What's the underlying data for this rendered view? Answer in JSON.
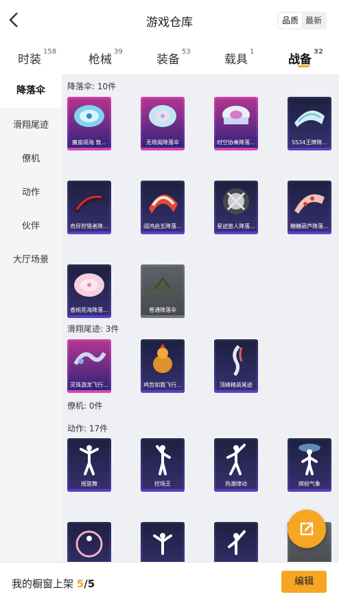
{
  "header": {
    "title": "游戏仓库",
    "sort": {
      "option1": "品质",
      "option2": "最新"
    }
  },
  "tabs": [
    {
      "label": "时装",
      "count": "158"
    },
    {
      "label": "枪械",
      "count": "39"
    },
    {
      "label": "装备",
      "count": "53"
    },
    {
      "label": "载具",
      "count": "1"
    },
    {
      "label": "战备",
      "count": "32"
    }
  ],
  "sidebar": {
    "items": [
      "降落伞",
      "滑翔尾迹",
      "僚机",
      "动作",
      "伙伴",
      "大厅场景"
    ]
  },
  "sections": {
    "parachute": {
      "label": "降落伞: 10件",
      "items": [
        "魔蛮闹海 敖...",
        "无垠阁降落伞",
        "时空协奏降落...",
        "SS34王牌降...",
        "奇异狩猎者降...",
        "阔鸿启五降落...",
        "星迹旅人降落...",
        "糖糖葫芦降落...",
        "香桃花海降落...",
        "普通降落伞"
      ]
    },
    "trail": {
      "label": "滑翔尾迹: 3件",
      "items": [
        "灵珠游龙飞行...",
        "鸡哲如我飞行...",
        "顶峰精英尾迹"
      ]
    },
    "wingman": {
      "label": "僚机: 0件"
    },
    "emote": {
      "label": "动作: 17件",
      "items": [
        "摇篮舞",
        "控场王",
        "热潮律动",
        "缤纷气象"
      ]
    }
  },
  "bottom": {
    "prefix": "我的橱窗上架 ",
    "current": "5",
    "total": "/5",
    "edit": "编辑"
  },
  "colors": {
    "accent": "#f5a623",
    "card_pink": "#cf3ea3",
    "card_purple": "#4a3796",
    "card_gray": "#5d6065"
  },
  "icons": {
    "back": "chevron-left-icon",
    "share": "share-external-icon"
  }
}
